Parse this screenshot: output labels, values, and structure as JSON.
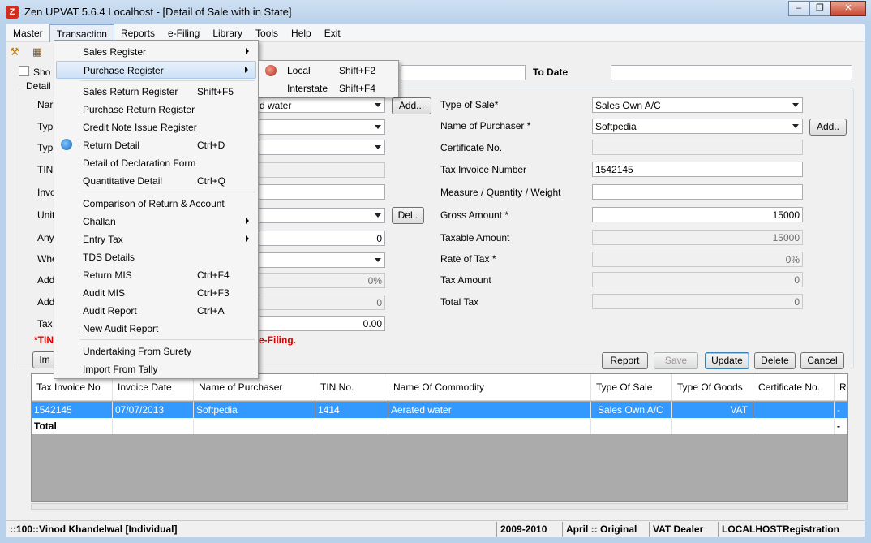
{
  "window": {
    "title": "Zen UPVAT 5.6.4 Localhost - [Detail of Sale with in State]",
    "app_icon": "Z",
    "minimize": "–",
    "restore": "❐",
    "close": "✕"
  },
  "menubar": [
    "Master",
    "Transaction",
    "Reports",
    "e-Filing",
    "Library",
    "Tools",
    "Help",
    "Exit"
  ],
  "transaction_menu": {
    "items": [
      {
        "label": "Sales Register",
        "shortcut": "",
        "submenu": true
      },
      {
        "label": "Purchase Register",
        "shortcut": "",
        "submenu": true
      },
      {
        "label": "Sales Return Register",
        "shortcut": "Shift+F5"
      },
      {
        "label": "Purchase Return Register",
        "shortcut": ""
      },
      {
        "label": "Credit Note Issue Register",
        "shortcut": ""
      },
      {
        "label": "Return Detail",
        "shortcut": "Ctrl+D"
      },
      {
        "label": "Detail of Declaration Form",
        "shortcut": ""
      },
      {
        "label": "Quantitative Detail",
        "shortcut": "Ctrl+Q"
      },
      {
        "label": "Comparison of Return & Account",
        "shortcut": ""
      },
      {
        "label": "Challan",
        "shortcut": "",
        "submenu": true
      },
      {
        "label": "Entry Tax",
        "shortcut": "",
        "submenu": true
      },
      {
        "label": "TDS Details",
        "shortcut": ""
      },
      {
        "label": "Return MIS",
        "shortcut": "Ctrl+F4"
      },
      {
        "label": "Audit MIS",
        "shortcut": "Ctrl+F3"
      },
      {
        "label": "Audit Report",
        "shortcut": "Ctrl+A"
      },
      {
        "label": "New Audit Report",
        "shortcut": ""
      },
      {
        "label": "Undertaking From Surety",
        "shortcut": ""
      },
      {
        "label": "Import From Tally",
        "shortcut": ""
      }
    ]
  },
  "purchase_submenu": [
    {
      "label": "Local",
      "shortcut": "Shift+F2"
    },
    {
      "label": "Interstate",
      "shortcut": "Shift+F4"
    }
  ],
  "top_form": {
    "show_label_partial": "Sho",
    "to_date_label": "To Date",
    "to_date_value": ""
  },
  "group_title": "Detail",
  "left_labels": [
    "Nar",
    "Typ",
    "Typ",
    "TIN",
    "Invo",
    "Unit",
    "Any",
    "Whe",
    "Add",
    "Add",
    "Tax"
  ],
  "left_fields": {
    "commodity_partial": "d water",
    "any_value": "0",
    "add1_value": "0%",
    "add2_value": "0",
    "tax_value": "0.00"
  },
  "buttons": {
    "add_commodity": "Add...",
    "del": "Del..",
    "add_purchaser": "Add..",
    "import_partial": "Im",
    "report": "Report",
    "save": "Save",
    "update": "Update",
    "delete": "Delete",
    "cancel": "Cancel"
  },
  "right_form": {
    "type_of_sale": {
      "label": "Type of Sale*",
      "value": "Sales Own A/C"
    },
    "name_of_purchaser": {
      "label": "Name of Purchaser *",
      "value": "Softpedia"
    },
    "certificate_no": {
      "label": "Certificate No.",
      "value": ""
    },
    "tax_invoice_number": {
      "label": "Tax Invoice Number",
      "value": "1542145"
    },
    "measure": {
      "label": "Measure / Quantity / Weight",
      "value": ""
    },
    "gross_amount": {
      "label": "Gross Amount  *",
      "value": "15000"
    },
    "taxable_amount": {
      "label": "Taxable Amount",
      "value": "15000"
    },
    "rate_of_tax": {
      "label": "Rate of Tax *",
      "value": "0%"
    },
    "tax_amount": {
      "label": "Tax Amount",
      "value": "0"
    },
    "total_tax": {
      "label": "Total Tax",
      "value": "0"
    }
  },
  "red_note": {
    "left": "*TIN",
    "right": "e-Filing."
  },
  "grid": {
    "columns": [
      "Tax Invoice No",
      "Invoice Date",
      "Name of Purchaser",
      "TIN No.",
      "Name Of Commodity",
      "Type Of Sale",
      "Type Of Goods",
      "Certificate No.",
      "R"
    ],
    "rows": [
      [
        "1542145",
        "07/07/2013",
        "Softpedia",
        "1414",
        "Aerated water",
        "Sales Own A/C",
        "VAT",
        "",
        "-"
      ]
    ],
    "total_label": "Total",
    "total_last": "-"
  },
  "statusbar": {
    "user": "::100::Vinod Khandelwal [Individual]",
    "year": "2009-2010",
    "period": "April :: Original",
    "dealer": "VAT Dealer",
    "host": "LOCALHOST",
    "registration": "Registration"
  }
}
